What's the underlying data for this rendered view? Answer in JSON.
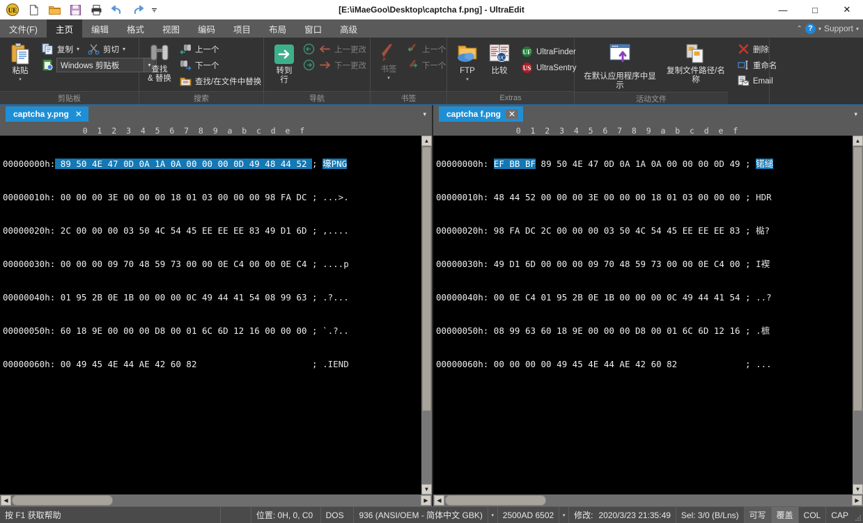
{
  "window": {
    "title": "[E:\\iMaeGoo\\Desktop\\captcha f.png] - UltraEdit",
    "minimize": "—",
    "maximize": "□",
    "close": "✕"
  },
  "quick_access": {
    "app_icon": "ultraedit-logo-icon",
    "items": [
      {
        "name": "new-file-icon",
        "label": "新建"
      },
      {
        "name": "open-folder-icon",
        "label": "打开"
      },
      {
        "name": "save-icon",
        "label": "保存"
      },
      {
        "name": "print-icon",
        "label": "打印"
      },
      {
        "name": "undo-icon",
        "label": "撤销"
      },
      {
        "name": "redo-icon",
        "label": "重做"
      },
      {
        "name": "qat-more-icon",
        "label": "▾"
      }
    ]
  },
  "menu": {
    "tabs": [
      {
        "label": "文件(F)",
        "active": false
      },
      {
        "label": "主页",
        "active": true
      },
      {
        "label": "编辑",
        "active": false
      },
      {
        "label": "格式",
        "active": false
      },
      {
        "label": "视图",
        "active": false
      },
      {
        "label": "编码",
        "active": false
      },
      {
        "label": "项目",
        "active": false
      },
      {
        "label": "布局",
        "active": false
      },
      {
        "label": "窗口",
        "active": false
      },
      {
        "label": "高级",
        "active": false
      }
    ],
    "right": {
      "collapse_caret": "⌃",
      "help": "?",
      "help_caret": "▾",
      "support_label": "Support",
      "support_caret": "▾"
    }
  },
  "ribbon": {
    "groups": [
      {
        "id": "clipboard",
        "label": "剪贴板",
        "paste_label": "粘贴",
        "paste_caret": "▾",
        "copy_label": "复制",
        "copy_caret": "▾",
        "cut_label": "剪切",
        "cut_caret": "▾",
        "clipboard_combo_value": "Windows 剪贴板",
        "combo_caret": "▾"
      },
      {
        "id": "search",
        "label": "搜索",
        "find_replace_label_1": "查找",
        "find_replace_label_2": "& 替换",
        "prev_label": "上一个",
        "next_label": "下一个",
        "find_in_files_label": "查找/在文件中替换"
      },
      {
        "id": "navigation",
        "label": "导航",
        "goto_line_label": "转到行",
        "back_label": "",
        "forward_label": "",
        "prev_change_label": "上一更改",
        "next_change_label": "下一更改"
      },
      {
        "id": "bookmark",
        "label": "书签",
        "bookmark_label": "书签",
        "bookmark_caret": "▾",
        "prev_label": "上一个",
        "next_label": "下一个"
      },
      {
        "id": "extras",
        "label": "Extras",
        "ftp_label": "FTP",
        "ftp_caret": "▾",
        "compare_label": "比较",
        "ultrafinder_label": "UltraFinder",
        "ultrasentry_label": "UltraSentry"
      },
      {
        "id": "active-file",
        "label": "活动文件",
        "show_in_default_app_label": "在默认应用程序中显示",
        "copy_path_label": "复制文件路径/名称",
        "delete_label": "删除",
        "rename_label": "重命名",
        "email_label": "Email"
      }
    ]
  },
  "panes": [
    {
      "id": "left",
      "tab_label": "captcha y.png",
      "tab_close": "✕",
      "tab_dropdown": "▾",
      "ruler": "   0  1  2  3  4  5  6  7  8  9  a  b  c  d  e  f",
      "lines": [
        {
          "offset": "00000000h:",
          "hex_selected": "89 50 4E 47 0D 0A 1A 0A 00 00 00 0D 49 48 44 52",
          "hex_plain": "",
          "sep": ";",
          "ascii_selected": "壕PNG",
          "ascii_plain": ""
        },
        {
          "offset": "00000010h:",
          "hex_selected": "",
          "hex_plain": "00 00 00 3E 00 00 00 18 01 03 00 00 00 98 FA DC",
          "sep": ";",
          "ascii_selected": "",
          "ascii_plain": "...>."
        },
        {
          "offset": "00000020h:",
          "hex_selected": "",
          "hex_plain": "2C 00 00 00 03 50 4C 54 45 EE EE EE 83 49 D1 6D",
          "sep": ";",
          "ascii_selected": "",
          "ascii_plain": ",...."
        },
        {
          "offset": "00000030h:",
          "hex_selected": "",
          "hex_plain": "00 00 00 09 70 48 59 73 00 00 0E C4 00 00 0E C4",
          "sep": ";",
          "ascii_selected": "",
          "ascii_plain": "....p"
        },
        {
          "offset": "00000040h:",
          "hex_selected": "",
          "hex_plain": "01 95 2B 0E 1B 00 00 00 0C 49 44 41 54 08 99 63",
          "sep": ";",
          "ascii_selected": "",
          "ascii_plain": ".?..."
        },
        {
          "offset": "00000050h:",
          "hex_selected": "",
          "hex_plain": "60 18 9E 00 00 00 D8 00 01 6C 6D 12 16 00 00 00",
          "sep": ";",
          "ascii_selected": "",
          "ascii_plain": "`.?.."
        },
        {
          "offset": "00000060h:",
          "hex_selected": "",
          "hex_plain": "00 49 45 4E 44 AE 42 60 82                     ",
          "sep": ";",
          "ascii_selected": "",
          "ascii_plain": ".IEND"
        }
      ]
    },
    {
      "id": "right",
      "tab_label": "captcha f.png",
      "tab_close": "✕",
      "tab_dropdown": "▾",
      "ruler": "   0  1  2  3  4  5  6  7  8  9  a  b  c  d  e  f",
      "lines": [
        {
          "offset": "00000000h:",
          "hex_selected": "EF BB BF",
          "hex_plain": " 89 50 4E 47 0D 0A 1A 0A 00 00 00 0D 49",
          "sep": ";",
          "ascii_selected": "锘縋",
          "ascii_plain": ""
        },
        {
          "offset": "00000010h:",
          "hex_selected": "",
          "hex_plain": "48 44 52 00 00 00 3E 00 00 00 18 01 03 00 00 00",
          "sep": ";",
          "ascii_selected": "",
          "ascii_plain": "HDR"
        },
        {
          "offset": "00000020h:",
          "hex_selected": "",
          "hex_plain": "98 FA DC 2C 00 00 00 03 50 4C 54 45 EE EE EE 83",
          "sep": ";",
          "ascii_selected": "",
          "ascii_plain": "檆?"
        },
        {
          "offset": "00000030h:",
          "hex_selected": "",
          "hex_plain": "49 D1 6D 00 00 00 09 70 48 59 73 00 00 0E C4 00",
          "sep": ";",
          "ascii_selected": "",
          "ascii_plain": "I褉"
        },
        {
          "offset": "00000040h:",
          "hex_selected": "",
          "hex_plain": "00 0E C4 01 95 2B 0E 1B 00 00 00 0C 49 44 41 54",
          "sep": ";",
          "ascii_selected": "",
          "ascii_plain": "..?"
        },
        {
          "offset": "00000050h:",
          "hex_selected": "",
          "hex_plain": "08 99 63 60 18 9E 00 00 00 D8 00 01 6C 6D 12 16",
          "sep": ";",
          "ascii_selected": "",
          "ascii_plain": ".樜"
        },
        {
          "offset": "00000060h:",
          "hex_selected": "",
          "hex_plain": "00 00 00 00 49 45 4E 44 AE 42 60 82            ",
          "sep": ";",
          "ascii_selected": "",
          "ascii_plain": "..."
        }
      ]
    }
  ],
  "statusbar": {
    "help_hint": "按 F1 获取帮助",
    "position": "位置: 0H, 0, C0",
    "line_ending": "DOS",
    "codepage": "936   (ANSI/OEM - 简体中文 GBK)",
    "codepage_caret": "▾",
    "bytes": "2500AD 6502",
    "bytes_caret": "▾",
    "modified_label": "修改:",
    "modified_value": "2020/3/23 21:35:49",
    "selection": "Sel: 3/0 (B/Lns)",
    "writable": "可写",
    "overwrite": "覆盖",
    "col": "COL",
    "cap": "CAP"
  },
  "colors": {
    "accent": "#1e8fd5",
    "selection": "#1478b4",
    "ribbon_bg": "#333333",
    "menu_bg": "#5a5a5a",
    "hex_bg": "#000000",
    "status_bg": "#4a4a4a"
  }
}
